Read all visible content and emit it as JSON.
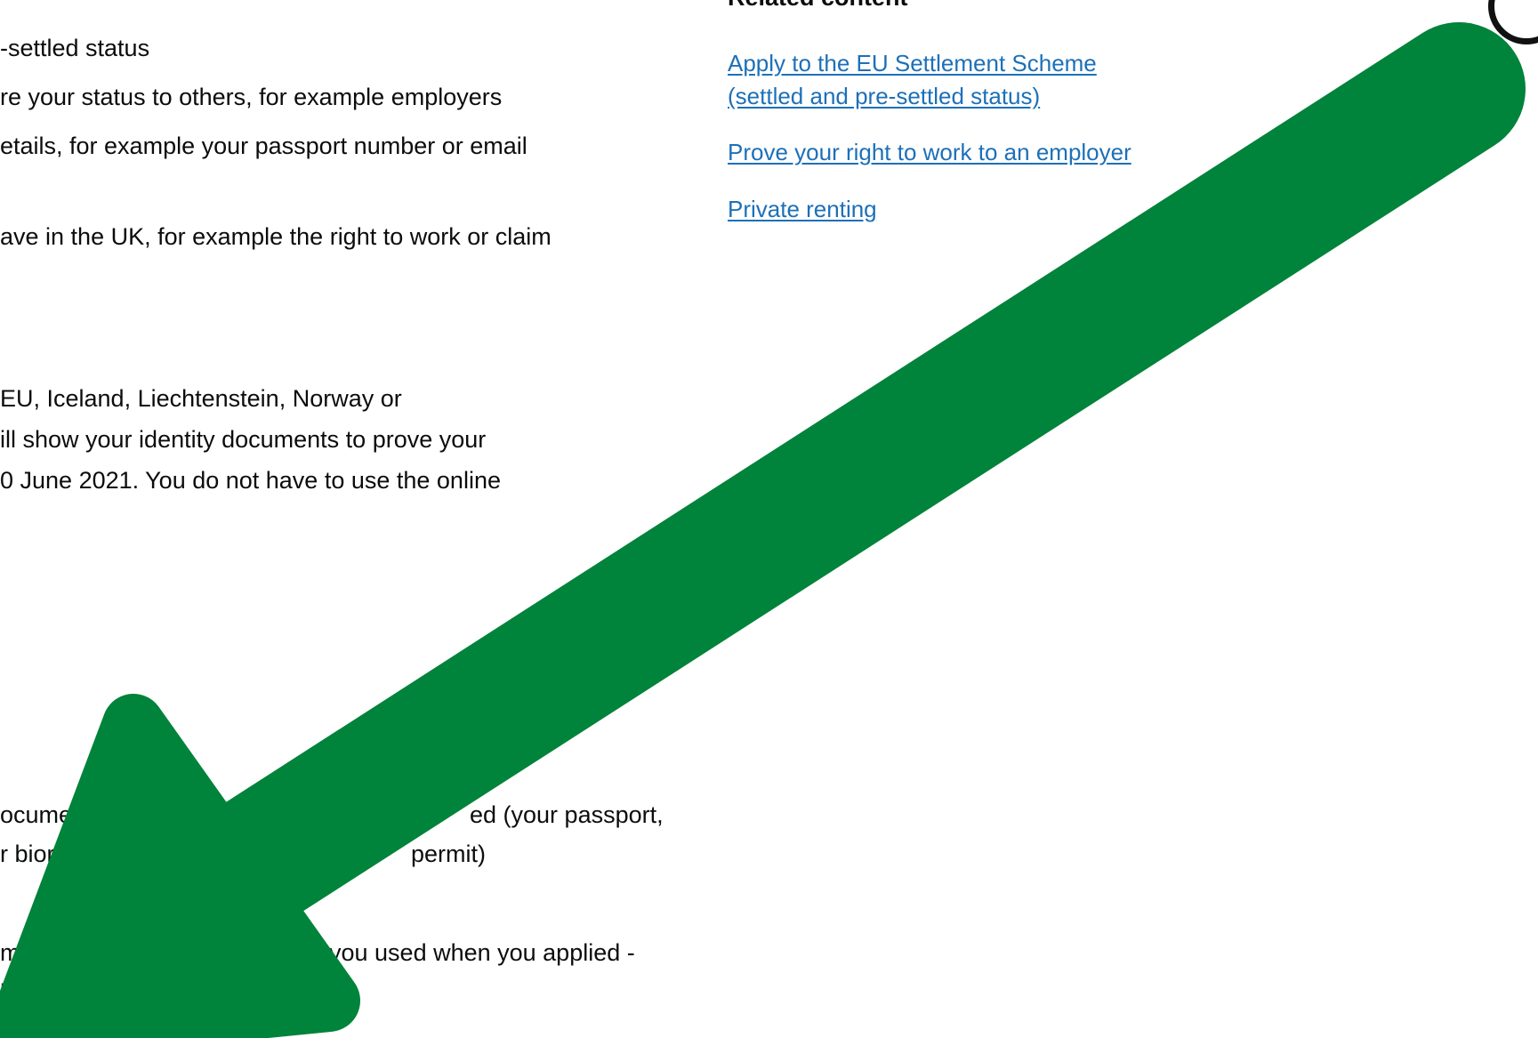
{
  "main": {
    "lines": [
      "-settled status",
      "re your status to others, for example employers",
      "etails, for example your passport number or email",
      "ave in the UK, for example the right to work or claim",
      " EU, Iceland, Liechtenstein, Norway or",
      "ill show your identity documents to prove your",
      "0 June 2021. You do not have to use the online",
      "ocume",
      "ed (your passport,",
      "r bior",
      "permit)",
      "m",
      "you used when you applied -",
      "l"
    ]
  },
  "sidebar": {
    "heading": "Related content",
    "links": [
      "Apply to the EU Settlement Scheme",
      "(settled and pre-settled status)",
      "Prove your right to work to an employer",
      "Private renting"
    ]
  },
  "overlay": {
    "arrow_color": "#00833a",
    "arrow_icon": "arrow-down-left-icon"
  }
}
